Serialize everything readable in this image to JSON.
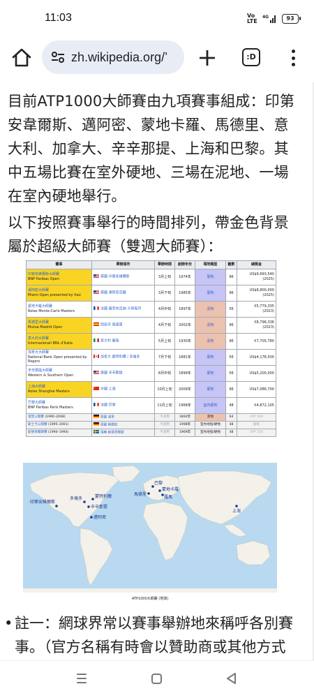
{
  "status_bar": {
    "time": "11:03",
    "network": "4G",
    "volte": "Vo LTE",
    "battery": "93"
  },
  "browser": {
    "url": "zh.wikipedia.org/’",
    "tabs_icon_label": ":D"
  },
  "article": {
    "para1": "目前ATP1000大師賽由九項賽事組成：印第安韋爾斯、邁阿密、蒙地卡羅、馬德里、意大利、加拿大、辛辛那提、上海和巴黎。其中五場比賽在室外硬地、三場在泥地、一場在室內硬地舉行。",
    "para2": "以下按照賽事舉行的時間排列，帶金色背景屬於超級大師賽（雙週大師賽）："
  },
  "table": {
    "headers": [
      "賽事",
      "舉辦城市",
      "舉辦時間",
      "創辦年份",
      "場地類型",
      "籤數",
      "總獎金"
    ],
    "rows": [
      {
        "event": "印第安維爾斯大師賽",
        "sponsor": "BNP Paribas Open",
        "gold": true,
        "flag": "us",
        "city": "美國 印第安維爾斯",
        "month": "3月上旬",
        "year": "1974年",
        "surface": "硬地",
        "surface_type": "hard",
        "draw": "96",
        "prize": "US$9,693,540",
        "prize_year": "(2025)"
      },
      {
        "event": "邁阿密大師賽",
        "sponsor": "Miami Open presented by Itaú",
        "gold": true,
        "flag": "us",
        "city": "美國 邁阿密花園",
        "month": "3月下旬",
        "year": "1985年",
        "surface": "硬地",
        "surface_type": "hard",
        "draw": "96",
        "prize": "US$8,800,000",
        "prize_year": "(2025)"
      },
      {
        "event": "蒙地卡羅大師賽",
        "sponsor": "Rolex Monte-Carlo Masters",
        "gold": false,
        "flag": "fr",
        "city": "法國 羅克布呂訥-卡普馬丹",
        "month": "4月中旬",
        "year": "1897年",
        "surface": "泥地",
        "surface_type": "clay",
        "draw": "56",
        "prize": "€5,779,335",
        "prize_year": "(2023)"
      },
      {
        "event": "馬德里大師賽",
        "sponsor": "Mutua Madrid Open",
        "gold": true,
        "flag": "es",
        "city": "西班牙 馬德里",
        "month": "4月下旬",
        "year": "2002年",
        "surface": "泥地",
        "surface_type": "clay",
        "draw": "96",
        "prize": "€8,796,336",
        "prize_year": "(2023)"
      },
      {
        "event": "意大利大師賽",
        "sponsor": "Internazionali BNL d'Italia",
        "gold": true,
        "flag": "it",
        "city": "意大利 羅馬",
        "month": "5月上旬",
        "year": "1930年",
        "surface": "泥地",
        "surface_type": "clay",
        "draw": "96",
        "prize": "€7,705,780",
        "prize_year": ""
      },
      {
        "event": "加拿大大師賽",
        "sponsor": "National Bank Open presented by Rogers",
        "gold": false,
        "flag": "ca",
        "city": "加拿大 蒙特利爾 / 多倫多",
        "month": "7月下旬",
        "year": "1881年",
        "surface": "硬地",
        "surface_type": "hard",
        "draw": "56",
        "prize": "US$4,178,500",
        "prize_year": ""
      },
      {
        "event": "辛辛那提大師賽",
        "sponsor": "Western & Southern Open",
        "gold": false,
        "flag": "us",
        "city": "美國 辛辛那提",
        "month": "8月中旬",
        "year": "1899年",
        "surface": "硬地",
        "surface_type": "hard",
        "draw": "56",
        "prize": "US$5,200,000",
        "prize_year": ""
      },
      {
        "event": "上海大師賽",
        "sponsor": "Rolex Shanghai Masters",
        "gold": true,
        "flag": "cn",
        "city": "中國 上海",
        "month": "10月上旬",
        "year": "2009年",
        "surface": "硬地",
        "surface_type": "hard",
        "draw": "96",
        "prize": "US$7,086,700",
        "prize_year": ""
      },
      {
        "event": "巴黎大師賽",
        "sponsor": "BNP Paribas Paris Masters",
        "gold": false,
        "flag": "fr",
        "city": "法國 巴黎",
        "month": "11月上旬",
        "year": "1968年",
        "surface": "室內硬地",
        "surface_type": "hard",
        "draw": "48",
        "prize": "€4,872,105",
        "prize_year": ""
      }
    ],
    "old_rows": [
      {
        "event": "漢堡公開賽",
        "years": "(1990–2008)",
        "flag": "de",
        "city": "德國 漢堡",
        "month": "不適用",
        "year": "1892年",
        "surface": "泥地",
        "surface_type": "clay",
        "draw": "64",
        "prize": "ATP 500"
      },
      {
        "event": "斯士卡公開賽",
        "years": "(1995–2001)",
        "flag": "de",
        "city": "德國 斯圖加",
        "month": "不適用",
        "year": "1998年",
        "surface": "室內地毯/硬地",
        "surface_type": "none",
        "draw": "48",
        "prize": "廢除"
      },
      {
        "event": "斯德哥爾摩賽",
        "years": "(1990–1994)",
        "flag": "se",
        "city": "瑞典 斯德哥爾摩",
        "month": "不適用",
        "year": "1969年",
        "surface": "室內地毯/硬地",
        "surface_type": "none",
        "draw": "48",
        "prize": "ATP 250"
      }
    ]
  },
  "map": {
    "caption": "ATP1000大師賽 (地球)",
    "labels": [
      "印第安維爾斯",
      "多倫多",
      "蒙特利爾",
      "辛辛那提",
      "邁阿密",
      "巴黎",
      "馬德里",
      "蒙地卡羅",
      "羅馬",
      "上海"
    ]
  },
  "footnote": {
    "text": "註一：網球界常以賽事舉辦地來稱呼各別賽事。（官方名稱有時會以贊助商或其他方式命名，故不一致。）"
  },
  "colors": {
    "gold": "#f9d423",
    "hard": "#c6c5f6",
    "clay": "#ebc2af",
    "link": "#3366cc",
    "url_pill": "#e8ecf5"
  }
}
